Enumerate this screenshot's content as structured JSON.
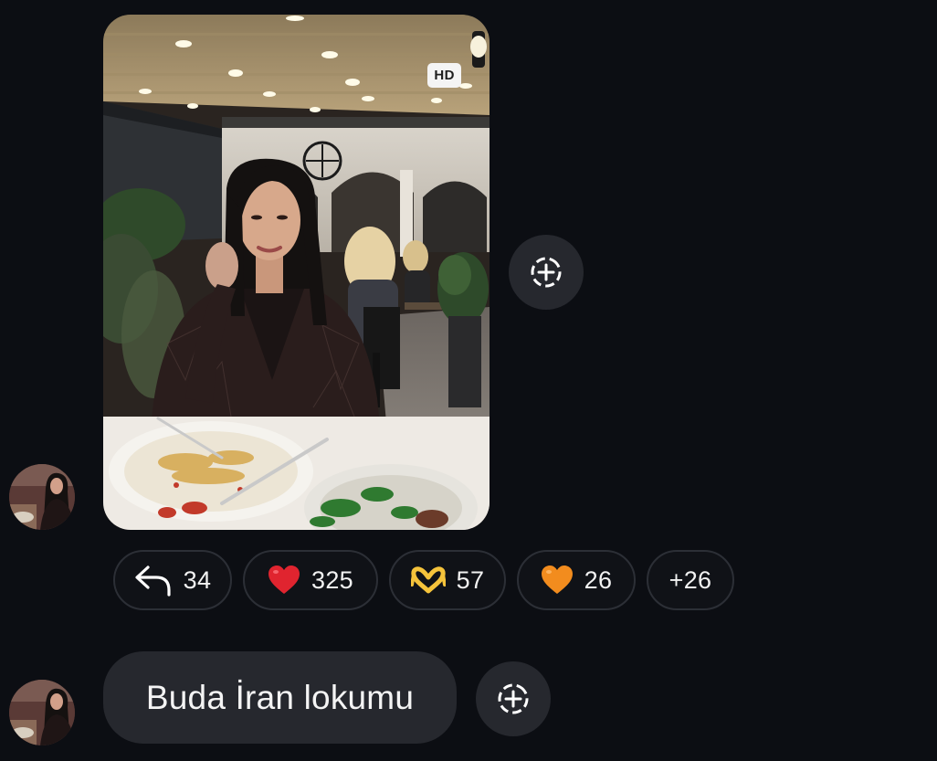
{
  "photo": {
    "hd_label": "HD",
    "icon": "restaurant-photo"
  },
  "reactions": [
    {
      "icon": "reply-icon",
      "count": "34"
    },
    {
      "icon": "red-heart-icon",
      "count": "325",
      "color": "#e0242f"
    },
    {
      "icon": "heart-hands-icon",
      "count": "57",
      "color": "#f5c33b"
    },
    {
      "icon": "orange-heart-icon",
      "count": "26",
      "color": "#f28c1e"
    },
    {
      "label": "+26"
    }
  ],
  "message": {
    "text": "Buda İran lokumu"
  },
  "colors": {
    "background": "#0c0e13",
    "bubble": "#26282e",
    "chip_border": "#2c2f36"
  }
}
